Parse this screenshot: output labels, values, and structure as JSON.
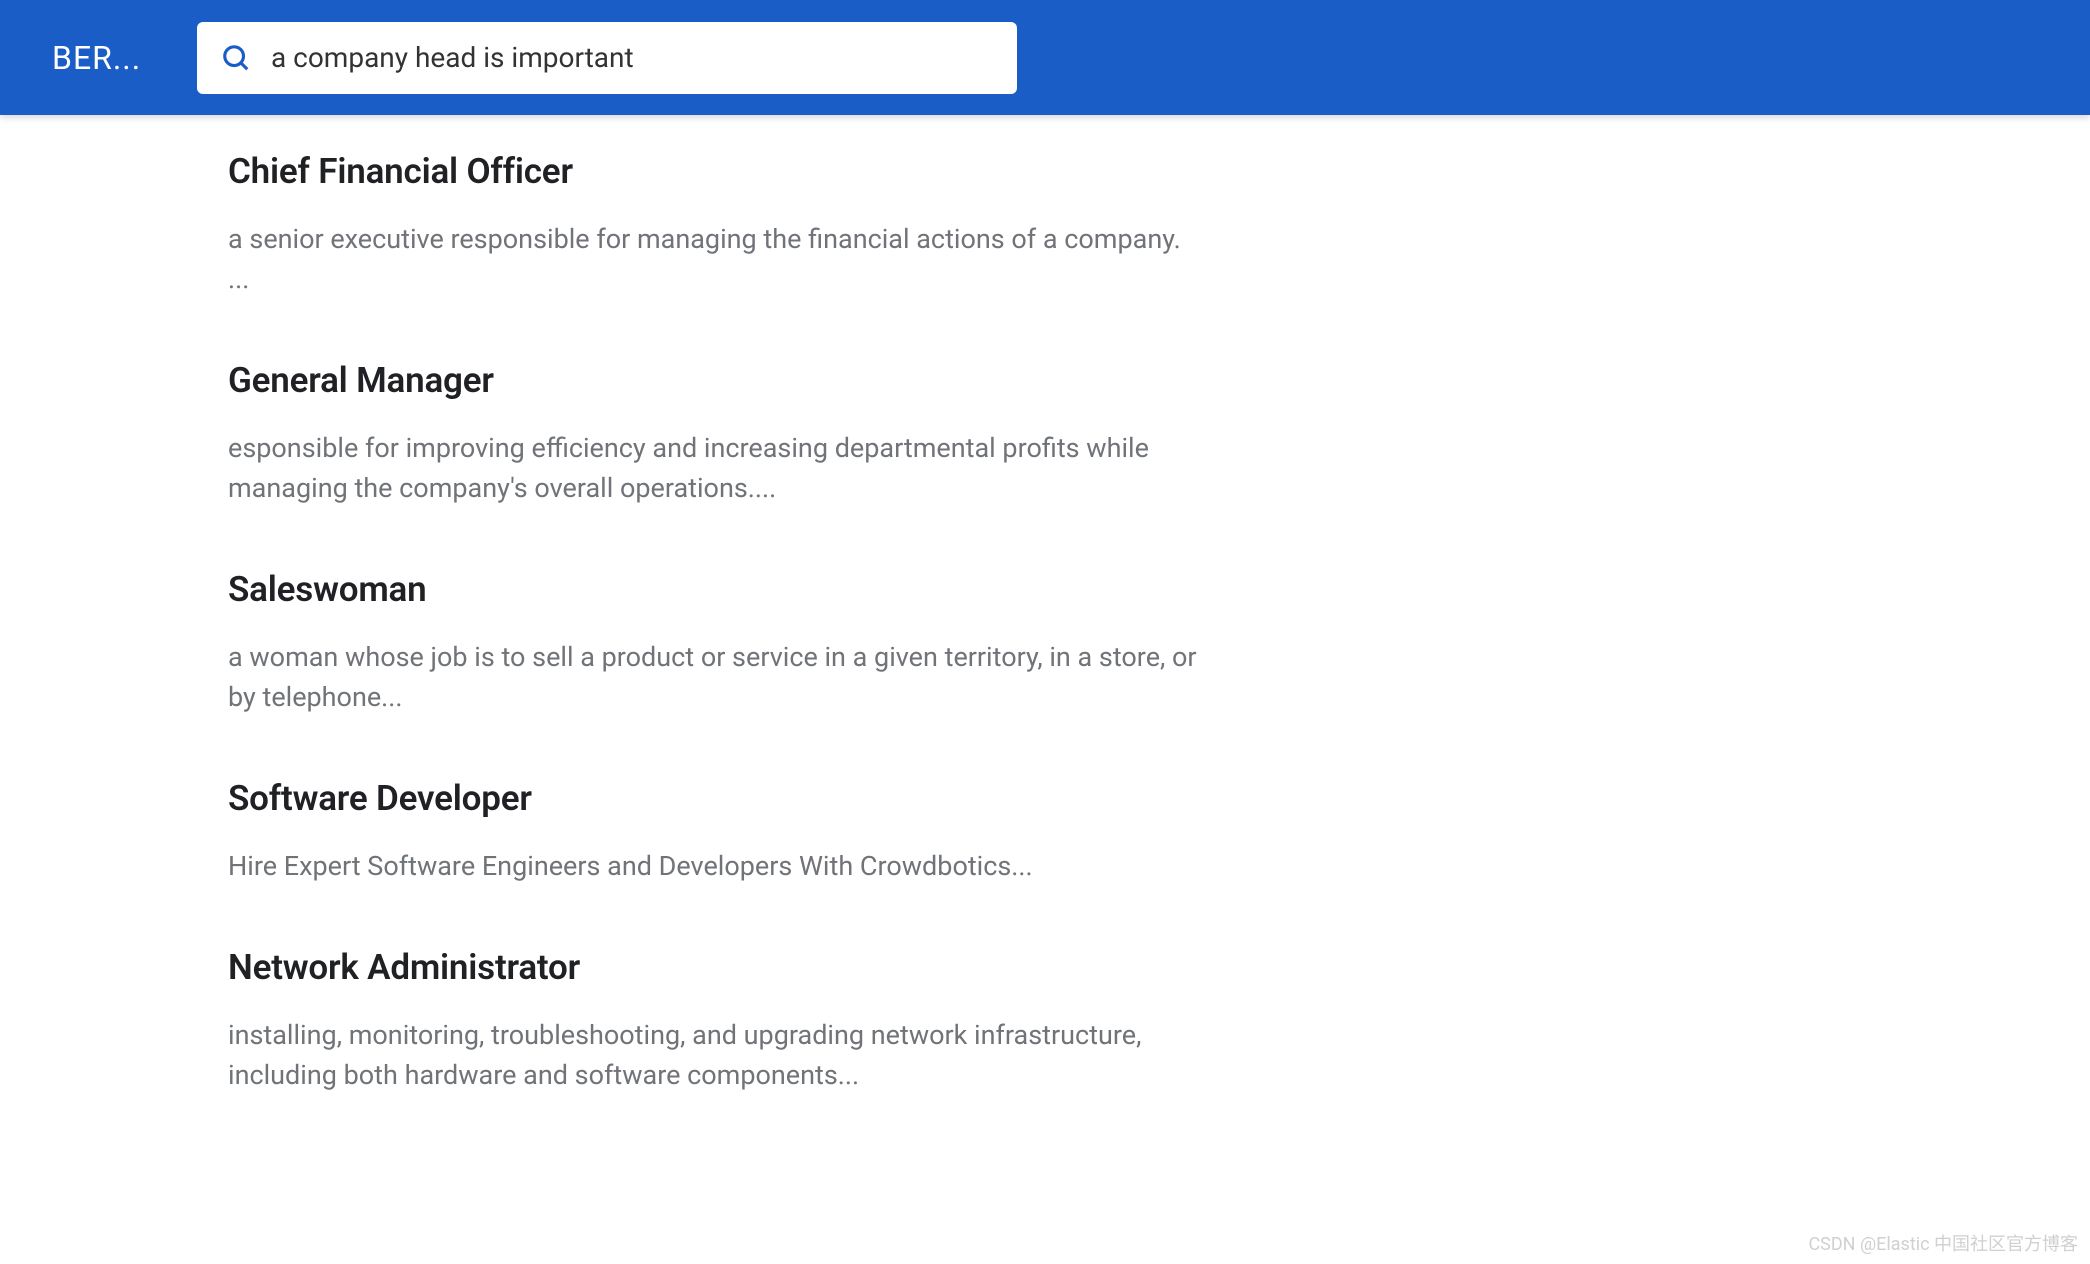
{
  "header": {
    "brand": "BER...",
    "search_value": "a company head is important"
  },
  "results": [
    {
      "title": "Chief Financial Officer",
      "description": "a senior executive responsible for managing the financial actions of a company. ..."
    },
    {
      "title": "General Manager",
      "description": "esponsible for improving efficiency and increasing departmental profits while managing the company's overall operations...."
    },
    {
      "title": "Saleswoman",
      "description": "a woman whose job is to sell a product or service in a given territory, in a store, or by telephone..."
    },
    {
      "title": "Software Developer",
      "description": "Hire Expert Software Engineers and Developers With Crowdbotics..."
    },
    {
      "title": "Network Administrator",
      "description": "installing, monitoring, troubleshooting, and upgrading network infrastructure, including both hardware and software components..."
    }
  ],
  "watermark": "CSDN @Elastic 中国社区官方博客"
}
